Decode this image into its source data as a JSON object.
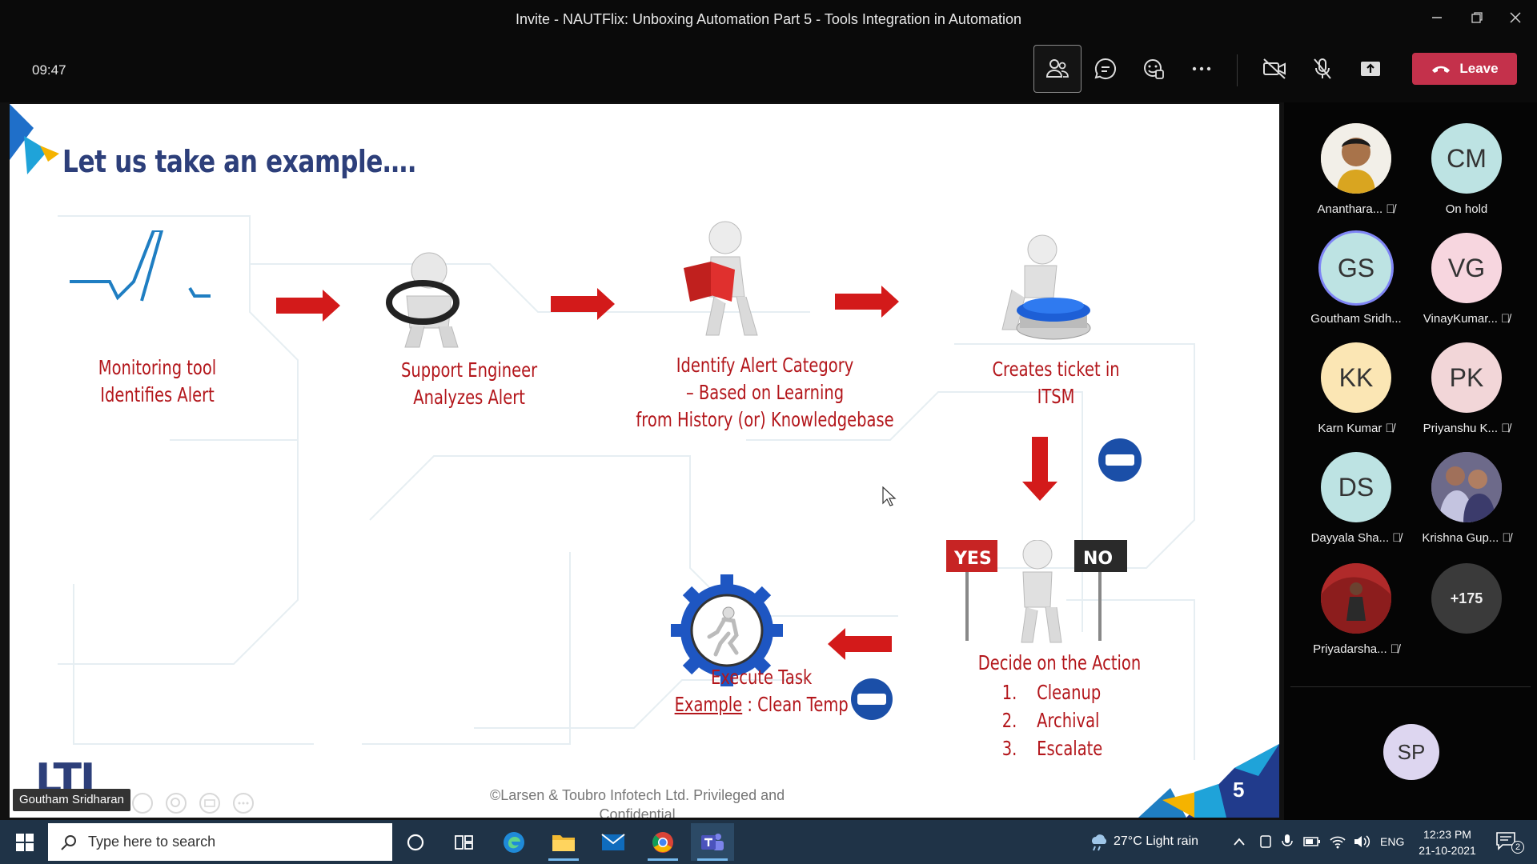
{
  "window": {
    "title": "Invite - NAUTFlix: Unboxing Automation Part 5 - Tools Integration in Automation",
    "controls": [
      "minimize",
      "restore",
      "close"
    ]
  },
  "toolbar": {
    "timer": "09:47",
    "buttons": [
      "people-icon",
      "chat-icon",
      "reactions-icon",
      "more-icon",
      "camera-off-icon",
      "mic-off-icon",
      "share-icon"
    ],
    "leave_label": "Leave",
    "leave_color": "#c4314b"
  },
  "slide": {
    "title": "Let us take an example….",
    "steps": {
      "monitoring": [
        "Monitoring tool",
        "Identifies Alert"
      ],
      "support": [
        "Support Engineer",
        "Analyzes Alert"
      ],
      "identify": [
        "Identify Alert Category",
        "– Based on Learning",
        "from History (or) Knowledgebase"
      ],
      "ticket": [
        "Creates ticket in",
        "ITSM"
      ],
      "decide_title": "Decide on the Action",
      "decide_items": [
        {
          "num": "1.",
          "text": "Cleanup"
        },
        {
          "num": "2.",
          "text": "Archival"
        },
        {
          "num": "3.",
          "text": "Escalate"
        }
      ],
      "execute_title": "Execute Task",
      "execute_example": "Example",
      "execute_rest": " : Clean Temp"
    },
    "sign_yes": "YES",
    "sign_no": "NO",
    "logo": "LTI",
    "copyright_line1": "©Larsen & Toubro Infotech Ltd. Privileged and",
    "copyright_line2": "Confidential",
    "slide_number": "5",
    "presenter": "Goutham Sridharan",
    "accent_color": "#b3161b",
    "title_color": "#2d3f7a"
  },
  "participants": [
    {
      "name": "Ananthara...",
      "initials": "",
      "photo": true,
      "muted": true,
      "bg": "#e8c9a0"
    },
    {
      "name": "On hold",
      "initials": "CM",
      "photo": false,
      "muted": false,
      "bg": "#bde3e3"
    },
    {
      "name": "Goutham Sridh...",
      "initials": "GS",
      "photo": false,
      "muted": false,
      "bg": "#bde3e3",
      "speaking": true
    },
    {
      "name": "VinayKumar...",
      "initials": "VG",
      "photo": false,
      "muted": true,
      "bg": "#f7d6df"
    },
    {
      "name": "Karn Kumar",
      "initials": "KK",
      "photo": false,
      "muted": true,
      "bg": "#fbe6b4"
    },
    {
      "name": "Priyanshu K...",
      "initials": "PK",
      "photo": false,
      "muted": true,
      "bg": "#f2d6d8"
    },
    {
      "name": "Dayyala Sha...",
      "initials": "DS",
      "photo": false,
      "muted": true,
      "bg": "#bde3e3"
    },
    {
      "name": "Krishna Gup...",
      "initials": "",
      "photo": true,
      "muted": true,
      "bg": "#8a7fa8"
    },
    {
      "name": "Priyadarsha...",
      "initials": "",
      "photo": true,
      "muted": true,
      "bg": "#b02a2a"
    }
  ],
  "more_participants": "+175",
  "self_initials": "SP",
  "taskbar": {
    "search_placeholder": "Type here to search",
    "weather": "27°C  Light rain",
    "lang": "ENG",
    "time": "12:23 PM",
    "date": "21-10-2021",
    "notifications": "2"
  }
}
